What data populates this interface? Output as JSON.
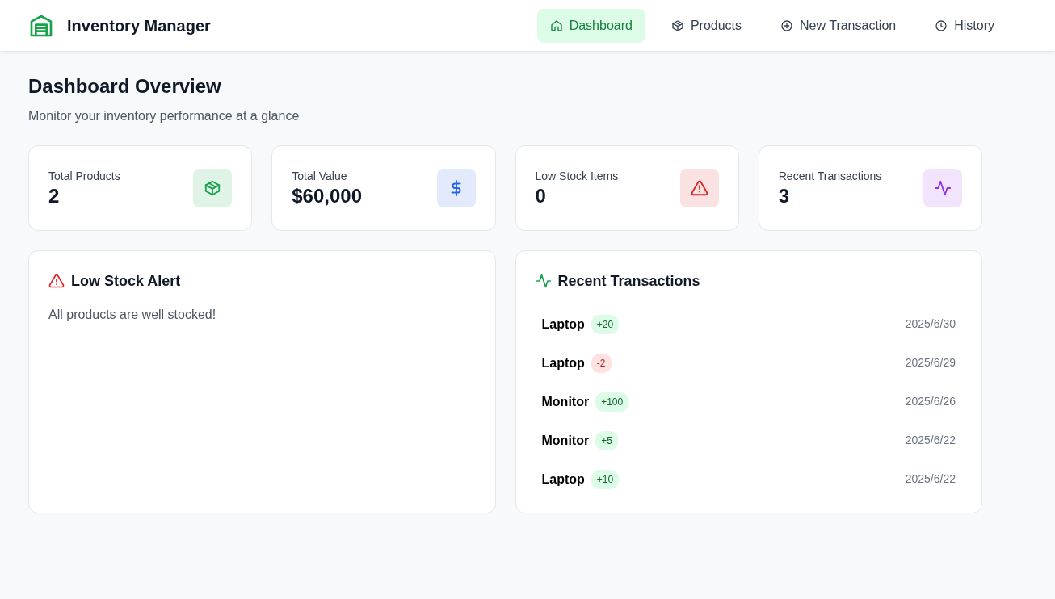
{
  "app": {
    "title": "Inventory Manager"
  },
  "nav": [
    {
      "label": "Dashboard",
      "selected": true
    },
    {
      "label": "Products",
      "selected": false
    },
    {
      "label": "New Transaction",
      "selected": false
    },
    {
      "label": "History",
      "selected": false
    }
  ],
  "page": {
    "title": "Dashboard Overview",
    "subtitle": "Monitor your inventory performance at a glance"
  },
  "stats": [
    {
      "label": "Total Products",
      "value": "2",
      "color": "#16a34a"
    },
    {
      "label": "Total Value",
      "value": "$60,000",
      "color": "#2563eb"
    },
    {
      "label": "Low Stock Items",
      "value": "0",
      "color": "#dc2626"
    },
    {
      "label": "Recent Transactions",
      "value": "3",
      "color": "#9333ea"
    }
  ],
  "low_stock": {
    "title": "Low Stock Alert",
    "message": "All products are well stocked!"
  },
  "recent": {
    "title": "Recent Transactions",
    "items": [
      {
        "product": "Laptop",
        "change": "+20",
        "kind": "in",
        "date": "2025/6/30"
      },
      {
        "product": "Laptop",
        "change": "-2",
        "kind": "out",
        "date": "2025/6/29"
      },
      {
        "product": "Monitor",
        "change": "+100",
        "kind": "in",
        "date": "2025/6/26"
      },
      {
        "product": "Monitor",
        "change": "+5",
        "kind": "in",
        "date": "2025/6/22"
      },
      {
        "product": "Laptop",
        "change": "+10",
        "kind": "in",
        "date": "2025/6/22"
      }
    ]
  }
}
